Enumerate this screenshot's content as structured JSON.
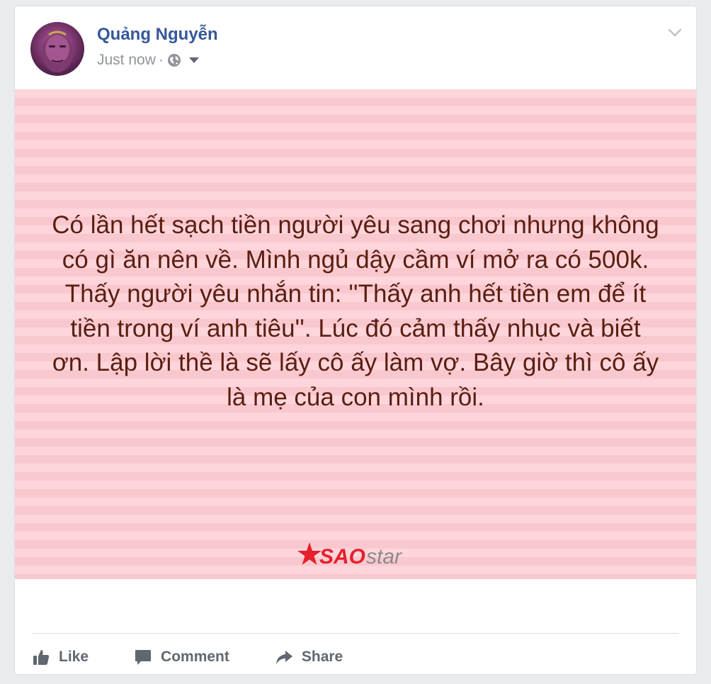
{
  "post": {
    "author": "Quảng Nguyễn",
    "timestamp": "Just now",
    "separator": "·",
    "privacy_icon": "globe-icon",
    "audience_menu_icon": "caret-down-icon",
    "options_icon": "chevron-down-icon",
    "background_color": "#fdd5db",
    "text_color": "#5b1e10",
    "text": "Có lần hết sạch tiền người yêu sang chơi nhưng không có gì ăn nên về. Mình ngủ dậy cầm ví mở ra có 500k. Thấy người yêu nhắn tin: ''Thấy anh hết tiền em để ít tiền trong ví anh tiêu''. Lúc đó cảm thấy nhục và biết ơn. Lập lời thề là sẽ lấy cô ấy làm vợ. Bây giờ thì cô ấy là mẹ của con mình rồi.",
    "watermark": "SAOstar"
  },
  "actions": {
    "like": "Like",
    "comment": "Comment",
    "share": "Share"
  },
  "colors": {
    "author": "#365899",
    "meta": "#90949c",
    "action": "#606770",
    "brand_red": "#e5202c"
  }
}
